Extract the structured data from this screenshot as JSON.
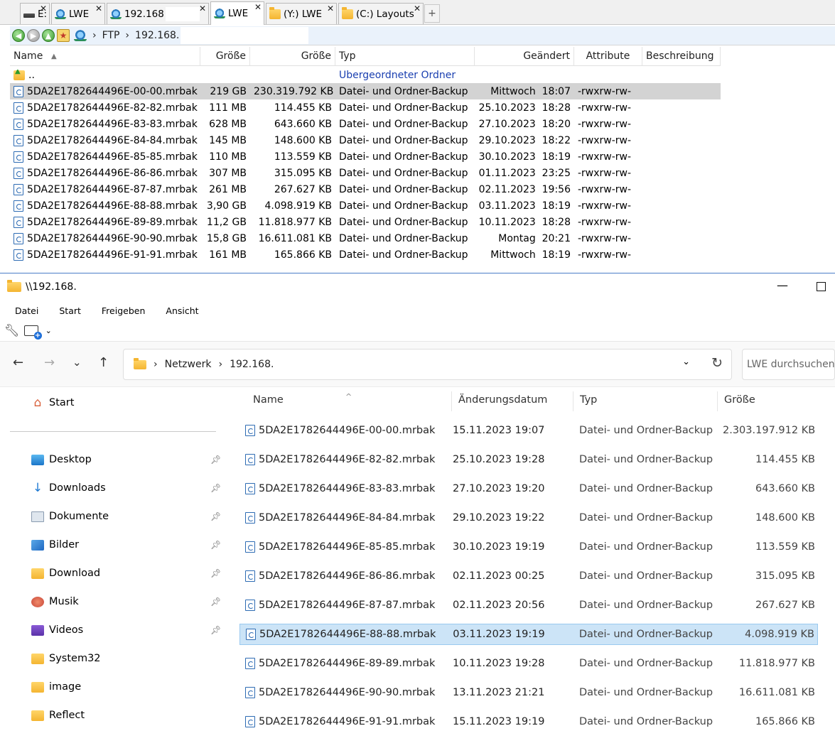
{
  "top": {
    "tabs": [
      {
        "label": "E:",
        "icon": "drive-icon"
      },
      {
        "label": "LWE",
        "icon": "network-icon"
      },
      {
        "label": "192.168",
        "icon": "network-icon"
      },
      {
        "label": "LWE",
        "icon": "network-icon",
        "active": true
      },
      {
        "label": "(Y:) LWE",
        "icon": "folder-icon"
      },
      {
        "label": "(C:) Layouts",
        "icon": "folder-icon"
      }
    ],
    "tab_close": "✕",
    "tab_plus": "+",
    "path": {
      "ftp": "FTP",
      "sep": "›",
      "host": "192.168."
    },
    "columns": {
      "name": "Name",
      "size1": "Größe",
      "size2": "Größe",
      "type": "Typ",
      "changed": "Geändert",
      "attr": "Attribute",
      "desc": "Beschreibung"
    },
    "parent": {
      "name": "..",
      "type": "Übergeordneter Ordner"
    },
    "rows": [
      {
        "name": "5DA2E1782644496E-00-00.mrbak",
        "size1": "219 GB",
        "size2": "230.319.792 KB",
        "type": "Datei- und Ordner-Backup",
        "date": "Mittwoch  18:07",
        "attr": "-rwxrw-rw-",
        "selected": true
      },
      {
        "name": "5DA2E1782644496E-82-82.mrbak",
        "size1": "111 MB",
        "size2": "114.455 KB",
        "type": "Datei- und Ordner-Backup",
        "date": "25.10.2023  18:28",
        "attr": "-rwxrw-rw-"
      },
      {
        "name": "5DA2E1782644496E-83-83.mrbak",
        "size1": "628 MB",
        "size2": "643.660 KB",
        "type": "Datei- und Ordner-Backup",
        "date": "27.10.2023  18:20",
        "attr": "-rwxrw-rw-"
      },
      {
        "name": "5DA2E1782644496E-84-84.mrbak",
        "size1": "145 MB",
        "size2": "148.600 KB",
        "type": "Datei- und Ordner-Backup",
        "date": "29.10.2023  18:22",
        "attr": "-rwxrw-rw-"
      },
      {
        "name": "5DA2E1782644496E-85-85.mrbak",
        "size1": "110 MB",
        "size2": "113.559 KB",
        "type": "Datei- und Ordner-Backup",
        "date": "30.10.2023  18:19",
        "attr": "-rwxrw-rw-"
      },
      {
        "name": "5DA2E1782644496E-86-86.mrbak",
        "size1": "307 MB",
        "size2": "315.095 KB",
        "type": "Datei- und Ordner-Backup",
        "date": "01.11.2023  23:25",
        "attr": "-rwxrw-rw-"
      },
      {
        "name": "5DA2E1782644496E-87-87.mrbak",
        "size1": "261 MB",
        "size2": "267.627 KB",
        "type": "Datei- und Ordner-Backup",
        "date": "02.11.2023  19:56",
        "attr": "-rwxrw-rw-"
      },
      {
        "name": "5DA2E1782644496E-88-88.mrbak",
        "size1": "3,90 GB",
        "size2": "4.098.919 KB",
        "type": "Datei- und Ordner-Backup",
        "date": "03.11.2023  18:19",
        "attr": "-rwxrw-rw-"
      },
      {
        "name": "5DA2E1782644496E-89-89.mrbak",
        "size1": "11,2 GB",
        "size2": "11.818.977 KB",
        "type": "Datei- und Ordner-Backup",
        "date": "10.11.2023  18:28",
        "attr": "-rwxrw-rw-"
      },
      {
        "name": "5DA2E1782644496E-90-90.mrbak",
        "size1": "15,8 GB",
        "size2": "16.611.081 KB",
        "type": "Datei- und Ordner-Backup",
        "date": "Montag  20:21",
        "attr": "-rwxrw-rw-"
      },
      {
        "name": "5DA2E1782644496E-91-91.mrbak",
        "size1": "161 MB",
        "size2": "165.866 KB",
        "type": "Datei- und Ordner-Backup",
        "date": "Mittwoch  18:19",
        "attr": "-rwxrw-rw-"
      }
    ]
  },
  "explorer": {
    "title": "\\\\192.168.",
    "window": {
      "minimize": "—"
    },
    "ribbon": [
      "Datei",
      "Start",
      "Freigeben",
      "Ansicht"
    ],
    "toolbar": {
      "caret": "⌄"
    },
    "nav": {
      "back": "←",
      "forward": "→",
      "recent": "⌄",
      "up": "↑"
    },
    "address": {
      "sep": "›",
      "network": "Netzwerk",
      "host": "192.168.",
      "chevron": "⌄",
      "refresh": "↻"
    },
    "search_placeholder": "LWE durchsuchen",
    "sidebar": [
      {
        "label": "Start",
        "icon": "home-icon"
      },
      {
        "label": "Desktop",
        "icon": "desktop-icon",
        "pinned": true
      },
      {
        "label": "Downloads",
        "icon": "download-arrow-icon",
        "pinned": true
      },
      {
        "label": "Dokumente",
        "icon": "document-icon",
        "pinned": true
      },
      {
        "label": "Bilder",
        "icon": "pictures-icon",
        "pinned": true
      },
      {
        "label": "Download",
        "icon": "folder-icon",
        "pinned": true
      },
      {
        "label": "Musik",
        "icon": "music-icon",
        "pinned": true
      },
      {
        "label": "Videos",
        "icon": "videos-icon",
        "pinned": true
      },
      {
        "label": "System32",
        "icon": "folder-icon"
      },
      {
        "label": "image",
        "icon": "folder-icon"
      },
      {
        "label": "Reflect",
        "icon": "folder-icon"
      }
    ],
    "columns": {
      "name": "Name",
      "date": "Änderungsdatum",
      "type": "Typ",
      "size": "Größe"
    },
    "sort_indicator": "^",
    "rows": [
      {
        "name": "5DA2E1782644496E-00-00.mrbak",
        "date": "15.11.2023 19:07",
        "type": "Datei- und Ordner-Backup",
        "size": "2.303.197.912 KB"
      },
      {
        "name": "5DA2E1782644496E-82-82.mrbak",
        "date": "25.10.2023 19:28",
        "type": "Datei- und Ordner-Backup",
        "size": "114.455 KB"
      },
      {
        "name": "5DA2E1782644496E-83-83.mrbak",
        "date": "27.10.2023 19:20",
        "type": "Datei- und Ordner-Backup",
        "size": "643.660 KB"
      },
      {
        "name": "5DA2E1782644496E-84-84.mrbak",
        "date": "29.10.2023 19:22",
        "type": "Datei- und Ordner-Backup",
        "size": "148.600 KB"
      },
      {
        "name": "5DA2E1782644496E-85-85.mrbak",
        "date": "30.10.2023 19:19",
        "type": "Datei- und Ordner-Backup",
        "size": "113.559 KB"
      },
      {
        "name": "5DA2E1782644496E-86-86.mrbak",
        "date": "02.11.2023 00:25",
        "type": "Datei- und Ordner-Backup",
        "size": "315.095 KB"
      },
      {
        "name": "5DA2E1782644496E-87-87.mrbak",
        "date": "02.11.2023 20:56",
        "type": "Datei- und Ordner-Backup",
        "size": "267.627 KB"
      },
      {
        "name": "5DA2E1782644496E-88-88.mrbak",
        "date": "03.11.2023 19:19",
        "type": "Datei- und Ordner-Backup",
        "size": "4.098.919 KB",
        "selected": true
      },
      {
        "name": "5DA2E1782644496E-89-89.mrbak",
        "date": "10.11.2023 19:28",
        "type": "Datei- und Ordner-Backup",
        "size": "11.818.977 KB"
      },
      {
        "name": "5DA2E1782644496E-90-90.mrbak",
        "date": "13.11.2023 21:21",
        "type": "Datei- und Ordner-Backup",
        "size": "16.611.081 KB"
      },
      {
        "name": "5DA2E1782644496E-91-91.mrbak",
        "date": "15.11.2023 19:19",
        "type": "Datei- und Ordner-Backup",
        "size": "165.866 KB"
      }
    ],
    "colors": {
      "selection": "#cce4f7",
      "selection_border": "#99c9ef",
      "tc_selection": "#d3d3d3",
      "link": "#1a3fb0"
    }
  }
}
